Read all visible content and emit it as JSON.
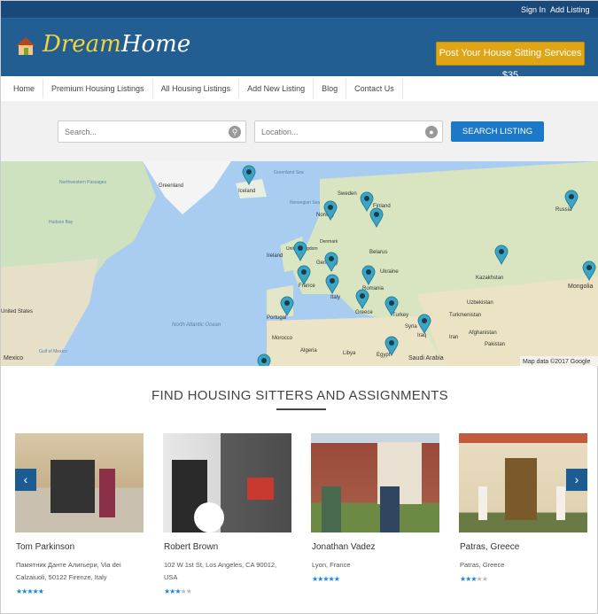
{
  "topbar": {
    "sign_in": "Sign In",
    "add_listing": "Add Listing"
  },
  "header": {
    "logo_part1": "Dream",
    "logo_part2": "Home",
    "post_button": "Post Your House Sitting Services $35"
  },
  "nav": [
    "Home",
    "Premium Housing Listings",
    "All Housing Listings",
    "Add New Listing",
    "Blog",
    "Contact Us"
  ],
  "search": {
    "placeholder": "Search...",
    "location_placeholder": "Location...",
    "button": "SEARCH LISTING"
  },
  "map": {
    "labels": [
      "Greenland",
      "Iceland",
      "Sweden",
      "Norway",
      "Finland",
      "Russia",
      "Denmark",
      "Belarus",
      "Ireland",
      "United Kingdom",
      "Germany",
      "Ukraine",
      "Kazakhstan",
      "Mongolia",
      "France",
      "Italy",
      "Romania",
      "Portugal",
      "Greece",
      "Turkey",
      "Uzbekistan",
      "Turkmenistan",
      "Syria",
      "Iraq",
      "Iran",
      "Afghanistan",
      "Pakistan",
      "Morocco",
      "Algeria",
      "Libya",
      "Egypt",
      "Saudi Arabia",
      "North Atlantic Ocean",
      "Hudson Bay",
      "Northwestern Passages",
      "United States",
      "Mexico",
      "Gulf of Mexico",
      "Greenland Sea",
      "Norwegian Sea"
    ],
    "attribution": "Map data ©2017 Google"
  },
  "section": {
    "title": "FIND HOUSING SITTERS AND ASSIGNMENTS"
  },
  "cards": [
    {
      "name": "Tom Parkinson",
      "address": "Памятник Данте Алигьери, Via dei Calzaiuoli, 50122 Firenze, Italy",
      "rating": 5
    },
    {
      "name": "Robert Brown",
      "address": "102 W 1st St, Los Angeles, CA 90012, USA",
      "rating": 3
    },
    {
      "name": "Jonathan Vadez",
      "address": "Lyon, France",
      "rating": 5
    },
    {
      "name": "Patras, Greece",
      "address": "Patras, Greece",
      "rating": 3
    }
  ],
  "colors": {
    "header": "#225e92",
    "topbar": "#18497a",
    "accent": "#dfa514",
    "button": "#1c79c9",
    "star": "#1f86d3"
  }
}
